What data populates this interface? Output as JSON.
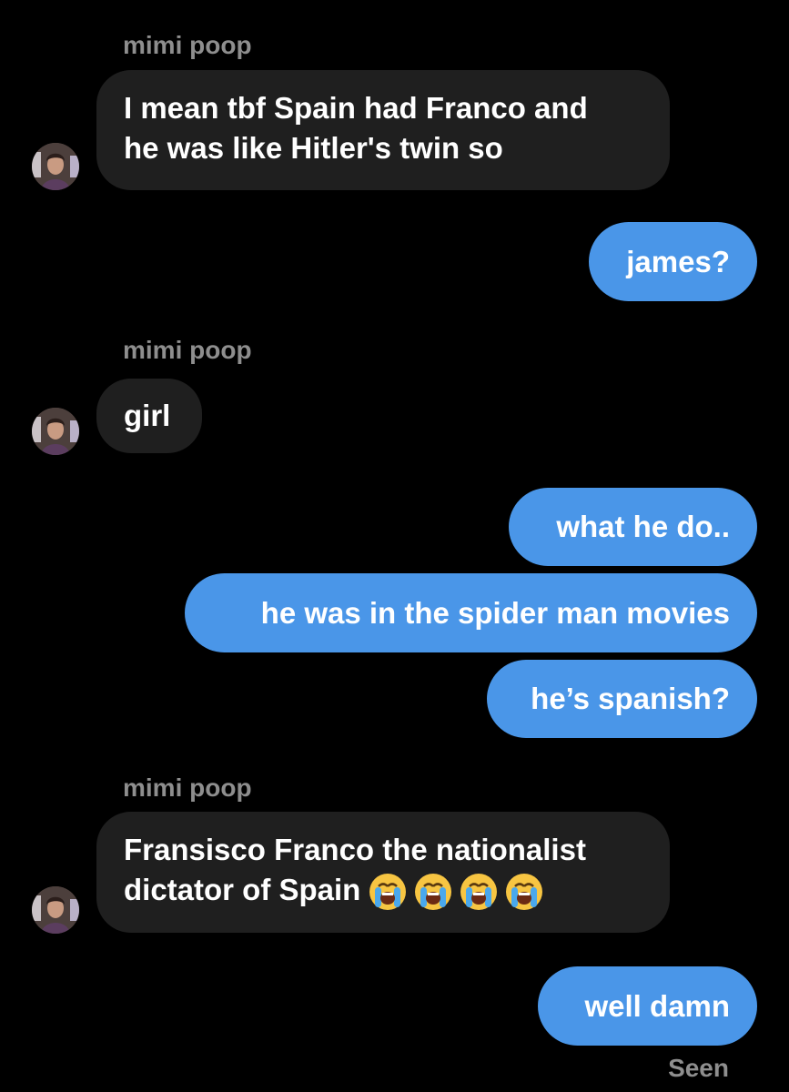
{
  "thread": {
    "messages": [
      {
        "direction": "incoming",
        "sender": "mimi poop",
        "lines": [
          "I mean tbf Spain had Franco and",
          "he was like Hitler's twin so"
        ]
      },
      {
        "direction": "outgoing",
        "text": "james?"
      },
      {
        "direction": "incoming",
        "sender": "mimi poop",
        "lines": [
          "girl"
        ]
      },
      {
        "direction": "outgoing",
        "text": "what he do.."
      },
      {
        "direction": "outgoing",
        "text": "he was in the spider man movies"
      },
      {
        "direction": "outgoing",
        "text": "he’s spanish?"
      },
      {
        "direction": "incoming",
        "sender": "mimi poop",
        "lines": [
          "Fransisco Franco the nationalist",
          "dictator of Spain"
        ],
        "emojis": [
          "loudly-crying-face",
          "loudly-crying-face",
          "loudly-crying-face",
          "loudly-crying-face"
        ]
      },
      {
        "direction": "outgoing",
        "text": "well damn"
      }
    ],
    "seen_label": "Seen"
  },
  "colors": {
    "background": "#000000",
    "incoming_bubble": "#1f1f1f",
    "outgoing_bubble": "#4a96e8",
    "muted_text": "#8e8e8e"
  },
  "icons": {
    "avatar": "profile-photo",
    "emoji": "loudly-crying-face-emoji"
  }
}
